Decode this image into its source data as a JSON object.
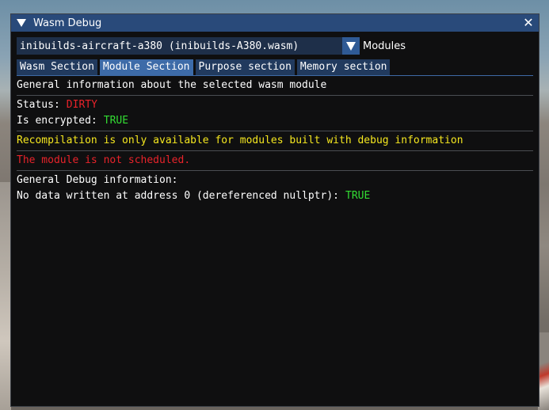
{
  "window": {
    "title": "Wasm Debug",
    "close_glyph": "✕"
  },
  "module_selector": {
    "value": "inibuilds-aircraft-a380 (inibuilds-A380.wasm)",
    "label": "Modules"
  },
  "tabs": [
    {
      "label": "Wasm Section",
      "active": false
    },
    {
      "label": "Module Section",
      "active": true
    },
    {
      "label": "Purpose section",
      "active": false
    },
    {
      "label": "Memory section",
      "active": false
    }
  ],
  "content": {
    "heading": "General information about the selected wasm module",
    "status_label": "Status:",
    "status_value": "DIRTY",
    "encrypted_label": "Is encrypted:",
    "encrypted_value": "TRUE",
    "recompilation_note": "Recompilation is only available for modules built with debug information",
    "schedule_note": "The module is not scheduled.",
    "debug_heading": "General Debug information:",
    "nullptr_label": "No data written at address 0 (dereferenced nullptr):",
    "nullptr_value": "TRUE"
  },
  "colors": {
    "titlebar": "#294a7a",
    "active_tab": "#3d6ba8",
    "inactive_tab": "#213a5e",
    "error_red": "#e8232a",
    "ok_green": "#33dd33",
    "warning_yellow": "#f5e71f"
  }
}
